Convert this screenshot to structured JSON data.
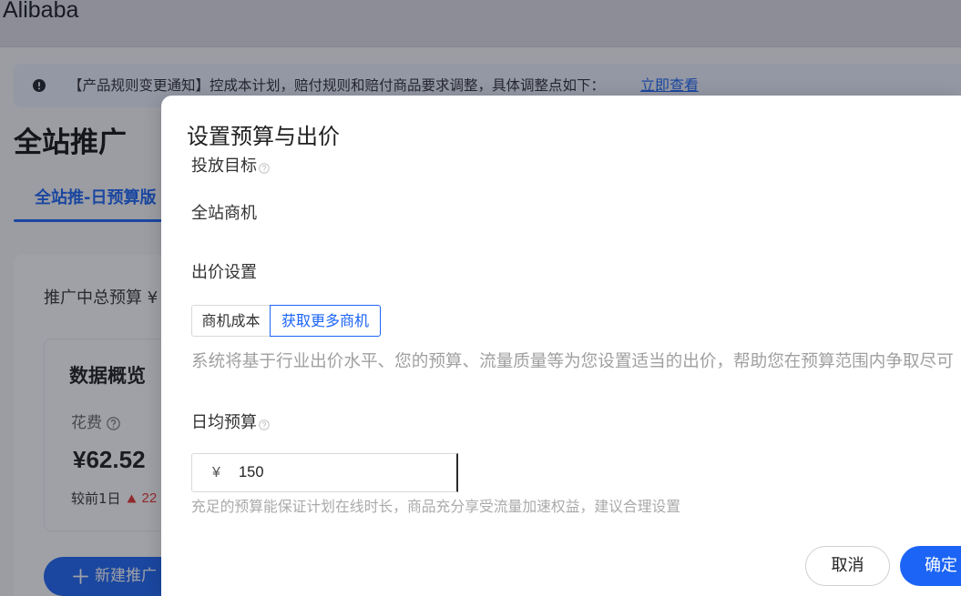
{
  "app": {
    "title": "Alibaba"
  },
  "notice": {
    "icon": "exclamation-circle-icon",
    "text": "【产品规则变更通知】控成本计划，赔付规则和赔付商品要求调整，具体调整点如下：",
    "link_label": "立即查看"
  },
  "page": {
    "title": "全站推广",
    "tabs": [
      {
        "label": "全站推-日预算版",
        "active": true
      }
    ],
    "total_budget_label": "推广中总预算 ¥",
    "overview": {
      "title": "数据概览",
      "spend_label": "花费",
      "spend_help_icon": "question-circle-icon",
      "spend_value": "¥62.52",
      "compare_label": "较前1日",
      "compare_trend_icon": "triangle-up-icon",
      "compare_value": "22"
    },
    "new_button": {
      "icon": "plus-icon",
      "label": "新建推广"
    }
  },
  "modal": {
    "title": "设置预算与出价",
    "goal": {
      "label": "投放目标",
      "help_icon": "question-circle-icon",
      "value": "全站商机"
    },
    "bid": {
      "label": "出价设置",
      "options": [
        {
          "label": "商机成本",
          "selected": false
        },
        {
          "label": "获取更多商机",
          "selected": true
        }
      ],
      "description": "系统将基于行业出价水平、您的预算、流量质量等为您设置适当的出价，帮助您在预算范围内争取尽可"
    },
    "daily_budget": {
      "label": "日均预算",
      "help_icon": "question-circle-icon",
      "currency": "¥",
      "value": "150",
      "hint": "充足的预算能保证计划在线时长，商品充分享受流量加速权益，建议合理设置"
    },
    "cancel_label": "取消",
    "confirm_label": "确定"
  },
  "colors": {
    "primary": "#1b64f5",
    "trend_up": "#e5322d"
  }
}
